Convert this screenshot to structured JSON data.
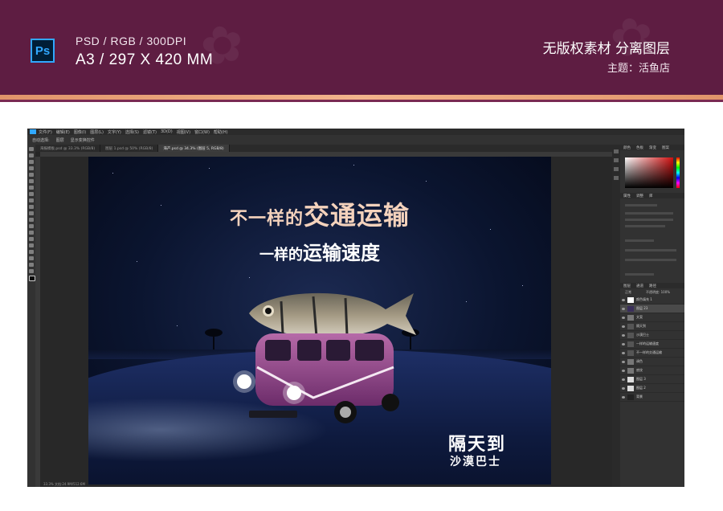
{
  "header": {
    "app_badge": "Ps",
    "spec_line1": "PSD / RGB / 300DPI",
    "spec_line2": "A3 / 297 X 420 MM",
    "brand": "无版权素材 分离图层",
    "topic": "主题：活鱼店"
  },
  "photoshop": {
    "menu": [
      "文件(F)",
      "编辑(E)",
      "图像(I)",
      "图层(L)",
      "文字(Y)",
      "选择(S)",
      "滤镜(T)",
      "3D(D)",
      "视图(V)",
      "窗口(W)",
      "帮助(H)"
    ],
    "options": [
      "自动选择:",
      "图层",
      "显示变换控件"
    ],
    "tabs": [
      "海报模板.psd @ 33.3% (RGB/8)",
      "图层 1.psd @ 50% (RGB/8)",
      "海产.psd @ 34.3% (图层 5, RGB/8)"
    ],
    "panel_tabs_top": [
      "颜色",
      "色板",
      "渐变",
      "图案"
    ],
    "panel_tabs_mid": [
      "属性",
      "调整",
      "库"
    ],
    "panel_tabs_layers": [
      "图层",
      "通道",
      "路径"
    ],
    "blend_mode": "正常",
    "opacity_label": "不透明度: 100%",
    "fill_label": "填充: 100%",
    "layers": [
      "颜色填充 1",
      "图层 23",
      "文案",
      "隔天到",
      "沙漠巴士",
      "一样的运输速度",
      "不一样的交通运输",
      "调色",
      "底纹",
      "图层 3",
      "图层 2",
      "背景"
    ],
    "status": "33.3%  文档:24.9M/512.6M"
  },
  "artwork": {
    "headline1_prefix": "不一样的",
    "headline1_main": "交通运输",
    "headline2_prefix": "一样的",
    "headline2_main": "运输速度",
    "slogan_main": "隔天到",
    "slogan_sub": "沙漠巴士"
  }
}
